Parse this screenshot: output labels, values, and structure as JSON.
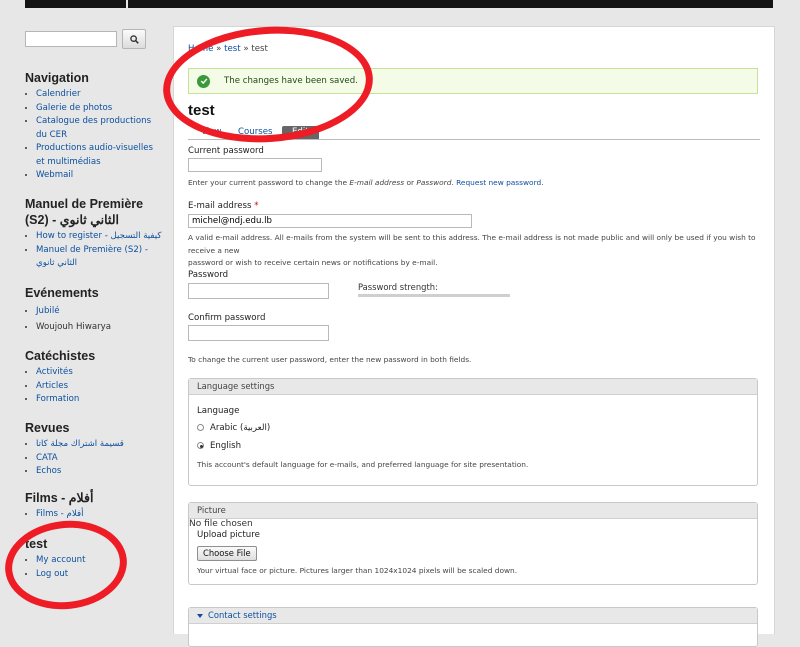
{
  "sidebar": {
    "search": {
      "placeholder": "",
      "button_icon": "search-icon"
    },
    "blocks": {
      "navigation": {
        "title": "Navigation",
        "items": [
          "Calendrier",
          "Galerie de photos",
          "Catalogue des productions du CER",
          "Productions audio-visuelles et multimédias",
          "Webmail"
        ]
      },
      "manuel": {
        "title": "Manuel de Première (S2) - الثاني ثانوي",
        "items": [
          "How to register - كيفية التسجيل",
          "Manuel de Première (S2) - الثاني ثانوي"
        ]
      },
      "evenements": {
        "title": "Evénements",
        "items": [
          "Jubilé",
          "Woujouh Hiwarya"
        ]
      },
      "catechistes": {
        "title": "Catéchistes",
        "items": [
          "Activités",
          "Articles",
          "Formation"
        ]
      },
      "revues": {
        "title": "Revues",
        "items": [
          "قسيمة اشتراك مجلة كاتا",
          "CATA",
          "Echos"
        ]
      },
      "films": {
        "title": "Films - أفلام",
        "items": [
          "Films - أفلام"
        ]
      },
      "user": {
        "title": "test",
        "items": [
          "My account",
          "Log out"
        ]
      }
    }
  },
  "main": {
    "breadcrumb": {
      "home": "Home",
      "sep": " » ",
      "test_link": "test",
      "current": "test"
    },
    "status_message": "The changes have been saved.",
    "page_title": "test",
    "tabs": {
      "view": "View",
      "courses": "Courses",
      "edit": "Edit"
    },
    "current_password": {
      "label": "Current password",
      "value": "",
      "desc_prefix": "Enter your current password to change the ",
      "desc_email": "E-mail address",
      "desc_or": " or ",
      "desc_password": "Password",
      "desc_dot": ". ",
      "desc_link": "Request new password",
      "desc_end": "."
    },
    "email": {
      "label": "E-mail address",
      "required": "*",
      "value": "michel@ndj.edu.lb",
      "desc_line1": "A valid e-mail address. All e-mails from the system will be sent to this address. The e-mail address is not made public and will only be used if you wish to receive a new",
      "desc_line2": "password or wish to receive certain news or notifications by e-mail."
    },
    "password": {
      "label": "Password",
      "strength_label": "Password strength:"
    },
    "confirm_password": {
      "label": "Confirm password"
    },
    "password_desc": "To change the current user password, enter the new password in both fields.",
    "language": {
      "legend": "Language settings",
      "label": "Language",
      "options": [
        "Arabic (العربية)",
        "English"
      ],
      "selected": "English",
      "desc": "This account's default language for e-mails, and preferred language for site presentation."
    },
    "picture": {
      "legend": "Picture",
      "label": "Upload picture",
      "button": "Choose File",
      "no_file": "No file chosen",
      "desc": "Your virtual face or picture. Pictures larger than 1024x1024 pixels will be scaled down."
    },
    "contact": {
      "legend": "Contact settings"
    }
  },
  "colors": {
    "annotation": "#ee1c24",
    "link": "#0b4f9e",
    "success_bg": "#f4fbe7"
  }
}
